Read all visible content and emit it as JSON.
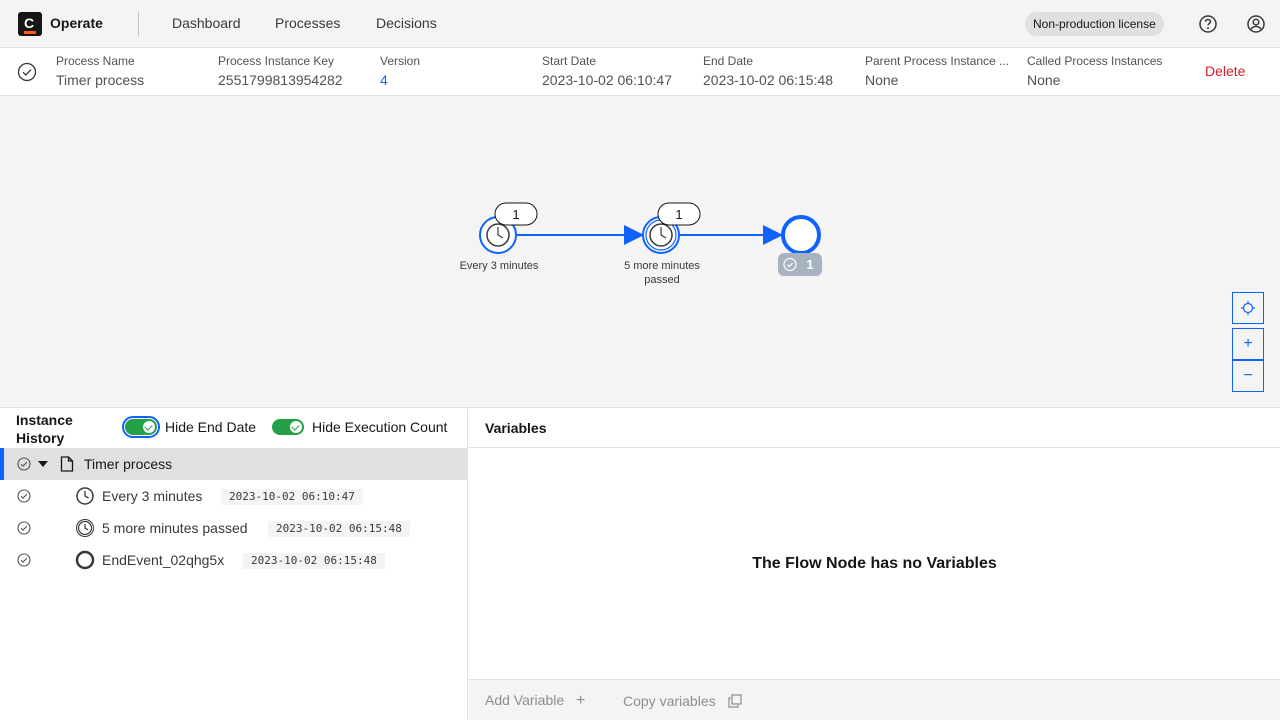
{
  "app": {
    "name": "Operate",
    "nav": [
      "Dashboard",
      "Processes",
      "Decisions"
    ],
    "license": "Non-production license"
  },
  "instance": {
    "fields": [
      {
        "label": "Process Name",
        "value": "Timer process"
      },
      {
        "label": "Process Instance Key",
        "value": "2551799813954282"
      },
      {
        "label": "Version",
        "value": "4"
      },
      {
        "label": "Start Date",
        "value": "2023-10-02 06:10:47"
      },
      {
        "label": "End Date",
        "value": "2023-10-02 06:15:48"
      },
      {
        "label": "Parent Process Instance ...",
        "value": "None"
      },
      {
        "label": "Called Process Instances",
        "value": "None"
      }
    ],
    "delete_label": "Delete"
  },
  "diagram": {
    "nodes": [
      {
        "label_line1": "Every 3 minutes",
        "label_line2": "",
        "count": "1"
      },
      {
        "label_line1": "5 more minutes",
        "label_line2": "passed",
        "count": "1"
      },
      {
        "label_line1": "",
        "label_line2": "",
        "count": "1"
      }
    ],
    "zoom": {
      "reset": "⌖",
      "in": "+",
      "out": "−"
    }
  },
  "history": {
    "title": "Instance History",
    "toggles": [
      "Hide End Date",
      "Hide Execution Count"
    ],
    "root": "Timer process",
    "items": [
      {
        "name": "Every 3 minutes",
        "date": "2023-10-02 06:10:47"
      },
      {
        "name": "5 more minutes passed",
        "date": "2023-10-02 06:15:48"
      },
      {
        "name": "EndEvent_02qhg5x",
        "date": "2023-10-02 06:15:48"
      }
    ]
  },
  "variables": {
    "title": "Variables",
    "empty": "The Flow Node has no Variables",
    "add": "Add Variable",
    "copy": "Copy variables"
  }
}
